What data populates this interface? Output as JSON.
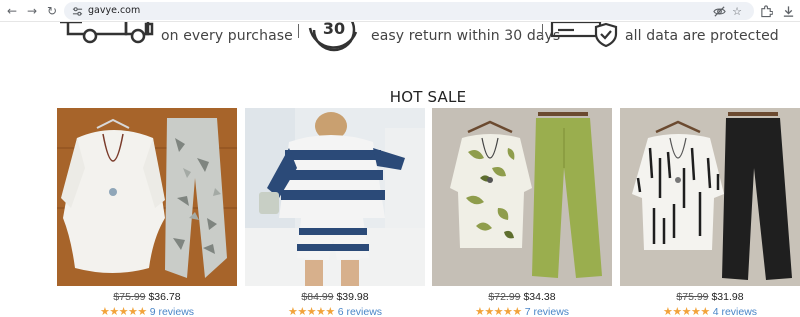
{
  "browser": {
    "url": "gavye.com",
    "icons": [
      "back-arrow-icon",
      "forward-arrow-icon",
      "reload-icon",
      "site-info-icon",
      "eye-off-icon",
      "star-icon",
      "extensions-icon",
      "download-icon"
    ]
  },
  "features": [
    {
      "icon": "delivery-truck-icon",
      "text": "on every purchase"
    },
    {
      "icon": "return-30-icon",
      "text": "easy return within 30 days"
    },
    {
      "icon": "secure-card-shield-icon",
      "text": "all data are protected"
    }
  ],
  "section_title": "HOT SALE",
  "products": [
    {
      "old_price": "$75.99",
      "price": "$36.78",
      "stars": "★★★★★",
      "reviews": "9 reviews",
      "image": "white-top-camo-pants"
    },
    {
      "old_price": "$84.99",
      "price": "$39.98",
      "stars": "★★★★★",
      "reviews": "6 reviews",
      "image": "striped-hoodie-shorts"
    },
    {
      "old_price": "$72.99",
      "price": "$34.38",
      "stars": "★★★★★",
      "reviews": "7 reviews",
      "image": "green-floral-set"
    },
    {
      "old_price": "$75.99",
      "price": "$31.98",
      "stars": "★★★★★",
      "reviews": "4 reviews",
      "image": "black-white-print-set"
    }
  ],
  "colors": {
    "star": "#f2a33a",
    "review_link": "#4a86c8"
  }
}
